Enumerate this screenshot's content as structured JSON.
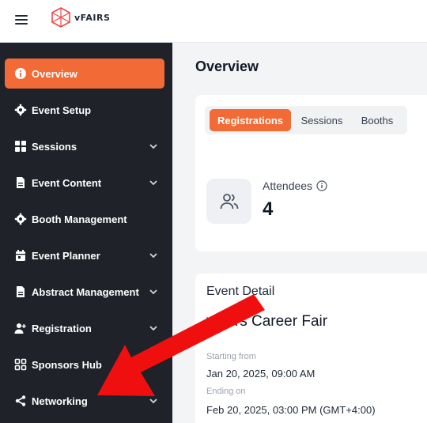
{
  "brand": {
    "logo_text": "vFAIRS",
    "accent": "#f26a35"
  },
  "sidebar": {
    "items": [
      {
        "label": "Overview",
        "icon": "info-icon",
        "active": true,
        "chevron": false
      },
      {
        "label": "Event Setup",
        "icon": "gear-icon",
        "chevron": false
      },
      {
        "label": "Sessions",
        "icon": "grid-icon",
        "chevron": true
      },
      {
        "label": "Event Content",
        "icon": "document-icon",
        "chevron": true
      },
      {
        "label": "Booth Management",
        "icon": "gear-icon",
        "chevron": false
      },
      {
        "label": "Event Planner",
        "icon": "calendar-icon",
        "chevron": true
      },
      {
        "label": "Abstract Management",
        "icon": "document-icon",
        "chevron": true
      },
      {
        "label": "Registration",
        "icon": "user-plus-icon",
        "chevron": true
      },
      {
        "label": "Sponsors Hub",
        "icon": "apps-icon",
        "chevron": false
      },
      {
        "label": "Networking",
        "icon": "share-icon",
        "chevron": true
      }
    ]
  },
  "main": {
    "title": "Overview",
    "tabs": [
      {
        "label": "Registrations",
        "active": true
      },
      {
        "label": "Sessions",
        "active": false
      },
      {
        "label": "Booths",
        "active": false
      }
    ],
    "stat": {
      "label": "Attendees",
      "value": "4"
    },
    "event": {
      "heading": "Event Detail",
      "name": "vFairs Career Fair",
      "start_label": "Starting from",
      "start_value": "Jan 20, 2025, 09:00 AM",
      "end_label": "Ending on",
      "end_value": "Feb 20, 2025, 03:00 PM (GMT+4:00)"
    }
  }
}
